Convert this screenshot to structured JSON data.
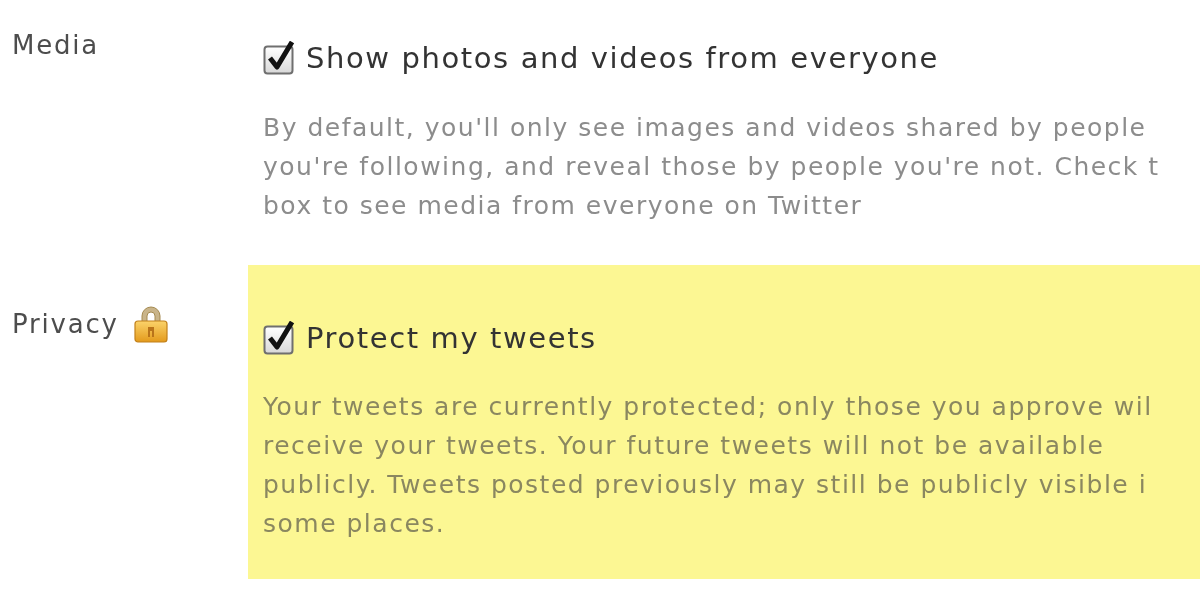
{
  "sections": [
    {
      "label": "Media",
      "locked": false,
      "highlighted": false,
      "checkbox": {
        "label": "Show photos and videos from everyone",
        "checked": true
      },
      "description_lines": [
        "By default, you'll only see images and videos shared by people",
        "you're following, and reveal those by people you're not. Check t",
        "box to see media from everyone on Twitter"
      ]
    },
    {
      "label": "Privacy",
      "locked": true,
      "highlighted": true,
      "checkbox": {
        "label": "Protect my tweets",
        "checked": true
      },
      "description_lines": [
        "Your tweets are currently protected; only those you approve wil",
        "receive your tweets. Your future tweets will not be available",
        "publicly. Tweets posted previously may still be publicly visible i",
        "some places."
      ]
    }
  ]
}
